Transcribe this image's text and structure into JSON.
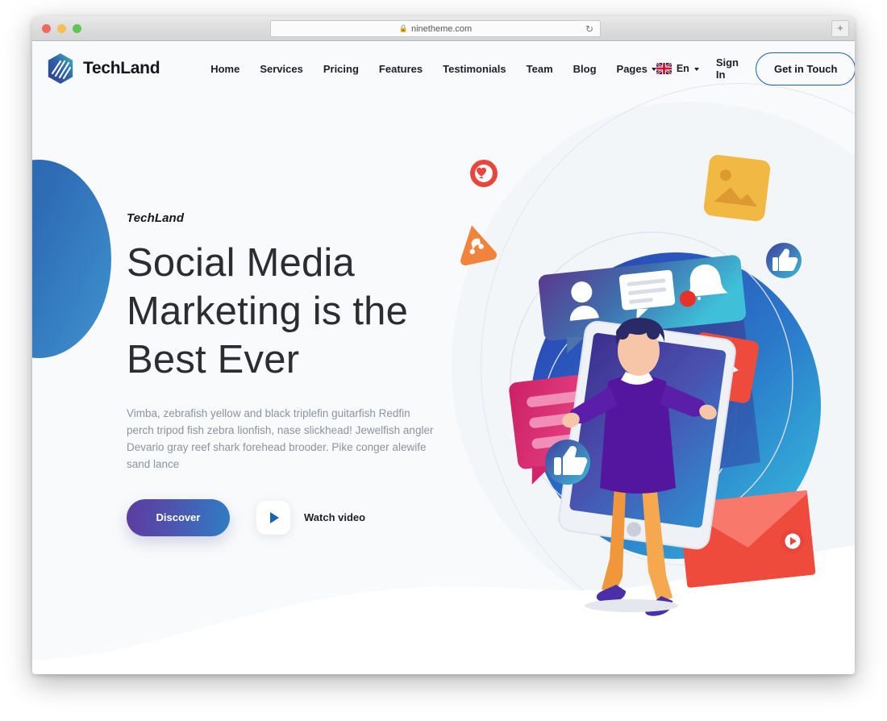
{
  "browser": {
    "url": "ninetheme.com",
    "lock_icon": "lock-icon",
    "reload_icon": "reload-icon",
    "new_tab_icon": "plus-icon",
    "traffic_lights": [
      "close-red",
      "minimize-yellow",
      "zoom-green"
    ]
  },
  "header": {
    "brand": {
      "name": "TechLand",
      "logo_icon": "techland-hexagon-logo"
    },
    "nav": [
      {
        "label": "Home",
        "has_dropdown": false
      },
      {
        "label": "Services",
        "has_dropdown": false
      },
      {
        "label": "Pricing",
        "has_dropdown": false
      },
      {
        "label": "Features",
        "has_dropdown": false
      },
      {
        "label": "Testimonials",
        "has_dropdown": false
      },
      {
        "label": "Team",
        "has_dropdown": false
      },
      {
        "label": "Blog",
        "has_dropdown": false
      },
      {
        "label": "Pages",
        "has_dropdown": true
      }
    ],
    "language": {
      "label": "En",
      "flag_icon": "uk-flag-icon",
      "caret_icon": "chevron-down-icon"
    },
    "sign_in_label": "Sign In",
    "cta_label": "Get in Touch",
    "menu_icon": "hamburger-menu-icon"
  },
  "hero": {
    "eyebrow": "TechLand",
    "title": "Social Media Marketing is the Best Ever",
    "paragraph": "Vimba, zebrafish yellow and black triplefin guitarfish Redfin perch tripod fish zebra lionfish, nase slickhead! Jewelfish angler Devario gray reef shark forehead brooder. Pike conger alewife sand lance",
    "primary_button": "Discover",
    "video_label": "Watch video",
    "play_icon": "play-triangle-icon",
    "illustration": "social-media-marketing-illustration"
  },
  "colors": {
    "brand_blue": "#1c5fae",
    "accent_purple": "#5c3c9e",
    "accent_teal": "#3f93ce",
    "page_bg": "#f9fafb",
    "heading": "#2c2d31",
    "body_text": "#8d939c",
    "badge_red": "#e8453c",
    "badge_orange": "#f09040",
    "badge_yellow": "#f2b844",
    "badge_pink": "#e0306e"
  }
}
